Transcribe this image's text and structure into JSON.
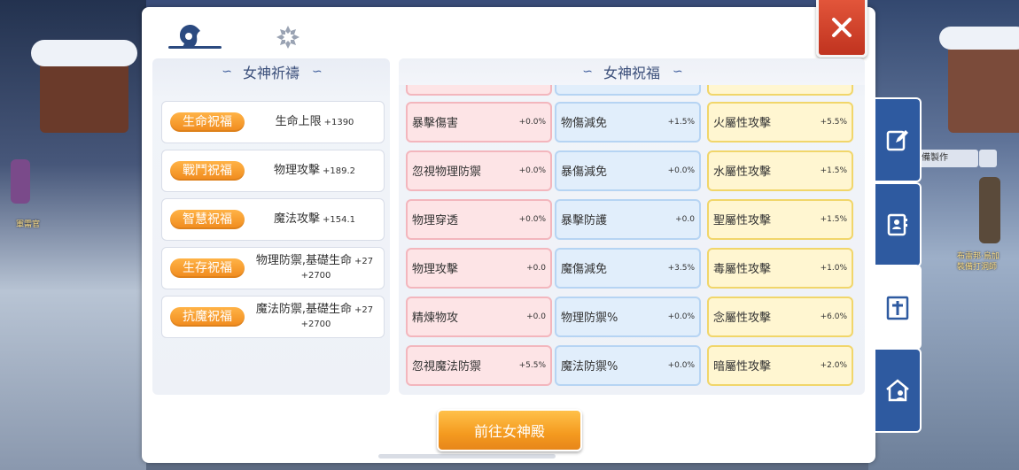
{
  "tabs": [
    {
      "icon": "goddess-head-icon"
    },
    {
      "icon": "snowflake-emblem-icon"
    }
  ],
  "close_icon": "close-icon",
  "prayer": {
    "title": "女神祈禱",
    "rows": [
      {
        "badge": "生命祝福",
        "stat": "生命上限",
        "value": "+1390"
      },
      {
        "badge": "戰鬥祝福",
        "stat": "物理攻擊",
        "value": "+189.2"
      },
      {
        "badge": "智慧祝福",
        "stat": "魔法攻擊",
        "value": "+154.1"
      },
      {
        "badge": "生存祝福",
        "stat": "物理防禦,基礎生命",
        "value": "+27",
        "value2": "+2700"
      },
      {
        "badge": "抗魔祝福",
        "stat": "魔法防禦,基礎生命",
        "value": "+27",
        "value2": "+2700"
      }
    ]
  },
  "blessing": {
    "title": "女神祝福",
    "columns": [
      {
        "color": "red",
        "cells": [
          {
            "name": "暴擊傷害",
            "value": "+0.0%"
          },
          {
            "name": "忽視物理防禦",
            "value": "+0.0%"
          },
          {
            "name": "物理穿透",
            "value": "+0.0%"
          },
          {
            "name": "物理攻擊",
            "value": "+0.0"
          },
          {
            "name": "精煉物攻",
            "value": "+0.0"
          },
          {
            "name": "忽視魔法防禦",
            "value": "+5.5%"
          }
        ]
      },
      {
        "color": "blue",
        "cells": [
          {
            "name": "物傷減免",
            "value": "+1.5%"
          },
          {
            "name": "暴傷減免",
            "value": "+0.0%"
          },
          {
            "name": "暴擊防護",
            "value": "+0.0"
          },
          {
            "name": "魔傷減免",
            "value": "+3.5%"
          },
          {
            "name": "物理防禦%",
            "value": "+0.0%"
          },
          {
            "name": "魔法防禦%",
            "value": "+0.0%"
          }
        ]
      },
      {
        "color": "yellow",
        "cells": [
          {
            "name": "火屬性攻擊",
            "value": "+5.5%"
          },
          {
            "name": "水屬性攻擊",
            "value": "+1.5%"
          },
          {
            "name": "聖屬性攻擊",
            "value": "+1.5%"
          },
          {
            "name": "毒屬性攻擊",
            "value": "+1.0%"
          },
          {
            "name": "念屬性攻擊",
            "value": "+6.0%"
          },
          {
            "name": "暗屬性攻擊",
            "value": "+2.0%"
          }
        ]
      }
    ]
  },
  "goto_button": "前往女神殿",
  "side_menu": [
    {
      "icon": "edit-icon",
      "active": false
    },
    {
      "icon": "contacts-book-icon",
      "active": false
    },
    {
      "icon": "shrine-icon",
      "active": true
    },
    {
      "icon": "guild-house-icon",
      "active": false
    }
  ],
  "background": {
    "npc_left": "軍需官",
    "npc_right_1": "布雷邦·烏加",
    "npc_right_2": "裝備打洞師",
    "chip": "備製作"
  },
  "colors": {
    "accent_orange": "#f49a1f",
    "close_red": "#d9432c",
    "side_blue": "#2e5aa0",
    "title_text": "#3b4f7a"
  }
}
